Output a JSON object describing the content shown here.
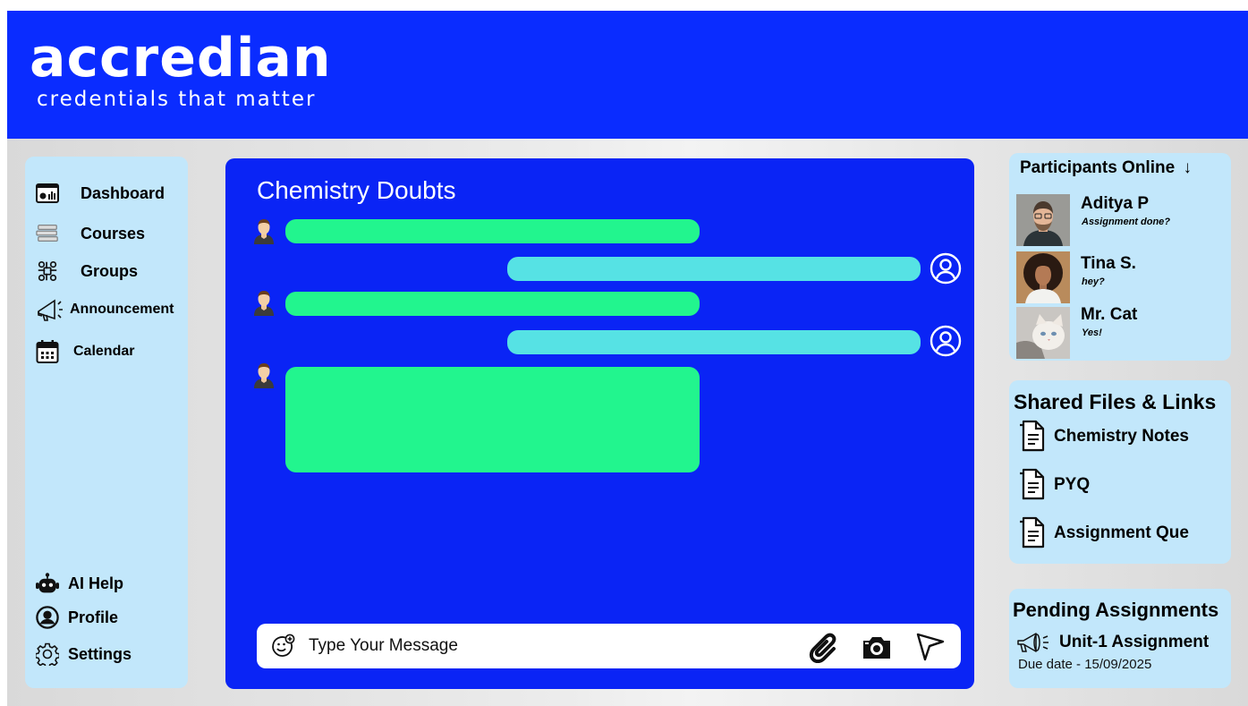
{
  "brand": {
    "name": "accredian",
    "tagline": "credentials that matter"
  },
  "colors": {
    "header": "#0a2cff",
    "chat_bg": "#0a24f5",
    "panel": "#c2e7fb",
    "bubble_in": "#22f58e",
    "bubble_out": "#56e2e4"
  },
  "sidebar": {
    "items": [
      {
        "label": "Dashboard",
        "icon": "dashboard-icon"
      },
      {
        "label": "Courses",
        "icon": "books-icon"
      },
      {
        "label": "Groups",
        "icon": "group-icon"
      },
      {
        "label": "Announcement",
        "icon": "megaphone-icon"
      },
      {
        "label": "Calendar",
        "icon": "calendar-icon"
      }
    ],
    "bottom": [
      {
        "label": "AI Help",
        "icon": "robot-icon"
      },
      {
        "label": "Profile",
        "icon": "profile-icon"
      },
      {
        "label": "Settings",
        "icon": "gear-icon"
      }
    ]
  },
  "chat": {
    "title": "Chemistry Doubts",
    "composer": {
      "placeholder": "Type Your Message"
    }
  },
  "participants": {
    "title": "Participants Online",
    "list": [
      {
        "name": "Aditya P",
        "message": "Assignment done?"
      },
      {
        "name": "Tina S.",
        "message": "hey?"
      },
      {
        "name": "Mr. Cat",
        "message": "Yes!"
      }
    ]
  },
  "shared": {
    "title": "Shared Files & Links",
    "files": [
      {
        "label": "Chemistry Notes"
      },
      {
        "label": "PYQ"
      },
      {
        "label": "Assignment Que"
      }
    ]
  },
  "pending": {
    "title": "Pending Assignments",
    "item": {
      "label": "Unit-1 Assignment",
      "due": "Due date - 15/09/2025"
    }
  }
}
